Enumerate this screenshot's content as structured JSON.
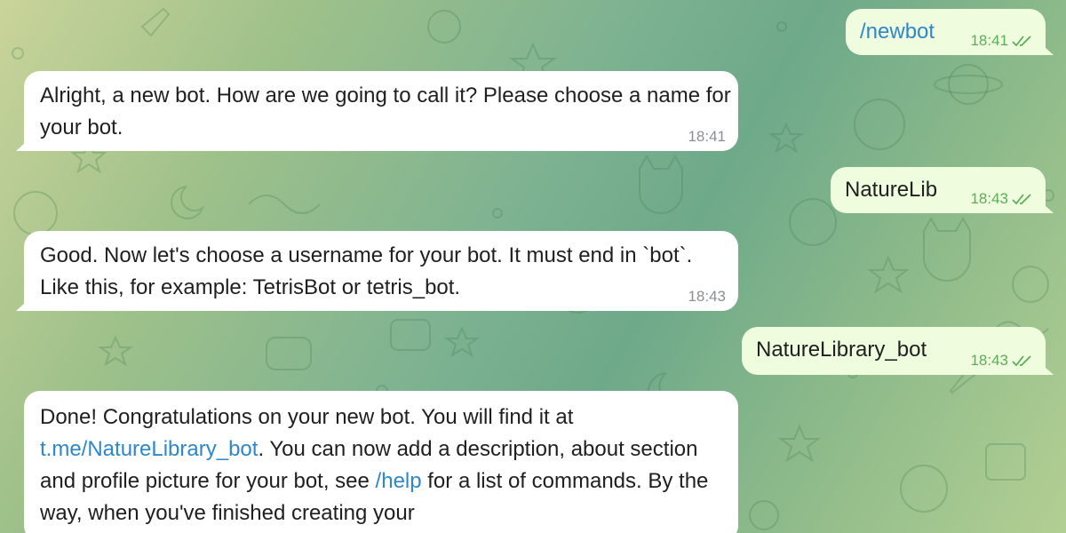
{
  "messages": [
    {
      "id": "m1",
      "dir": "out",
      "text": "/newbot",
      "time": "18:41"
    },
    {
      "id": "m2",
      "dir": "in",
      "text": "Alright, a new bot. How are we going to call it? Please choose a name for your bot.",
      "time": "18:41"
    },
    {
      "id": "m3",
      "dir": "out",
      "text": "NatureLib",
      "time": "18:43"
    },
    {
      "id": "m4",
      "dir": "in",
      "text": "Good. Now let's choose a username for your bot. It must end in `bot`. Like this, for example: TetrisBot or tetris_bot.",
      "time": "18:43"
    },
    {
      "id": "m5",
      "dir": "out",
      "text": "NatureLibrary_bot",
      "time": "18:43"
    },
    {
      "id": "m6",
      "dir": "in",
      "parts": {
        "p1": "Done! Congratulations on your new bot. You will find it at",
        "link": "t.me/NatureLibrary_bot",
        "p2": ". You can now add a description, about section and profile picture for your bot, see ",
        "help": "/help",
        "p3": " for a list of commands. By the way, when you've finished creating your"
      }
    }
  ],
  "colors": {
    "incoming_bubble": "#ffffff",
    "outgoing_bubble": "#effdde",
    "link": "#2e87c9",
    "outgoing_meta": "#5aae57",
    "incoming_meta": "#8b8f93"
  },
  "icons": {
    "read_receipt": "double-check-icon"
  }
}
